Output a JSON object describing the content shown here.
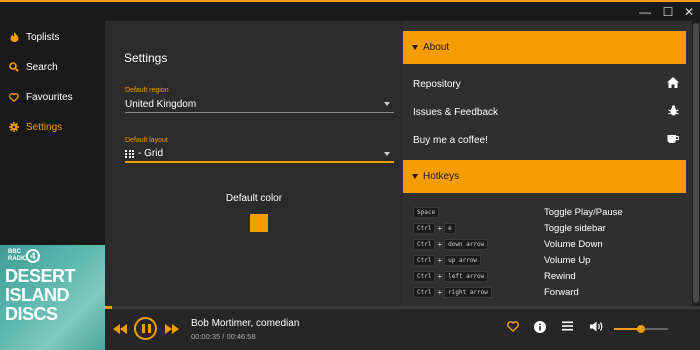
{
  "window": {
    "minimize_glyph": "—",
    "maximize_glyph": "☐",
    "close_glyph": "✕",
    "accent_color": "#f59c00"
  },
  "sidebar": {
    "items": [
      {
        "label": "Toplists",
        "icon": "flame-icon",
        "glyph": "🔥",
        "active": false
      },
      {
        "label": "Search",
        "icon": "search-icon",
        "glyph": "⌕",
        "active": false
      },
      {
        "label": "Favourites",
        "icon": "heart-icon",
        "glyph": "♡",
        "active": false
      },
      {
        "label": "Settings",
        "icon": "gear-icon",
        "glyph": "⚙",
        "active": true
      }
    ]
  },
  "album_art": {
    "bbc": "BBC",
    "radio": "RADIO",
    "four": "4",
    "line1": "DESERT",
    "line2": "ISLAND",
    "line3": "DISCS"
  },
  "settings": {
    "title": "Settings",
    "region_label": "Default region",
    "region_value": "United Kingdom",
    "layout_label": "Default layout",
    "layout_value": "- Grid",
    "default_color_label": "Default color",
    "default_color": "#f59c00"
  },
  "about": {
    "header": "About",
    "links": [
      {
        "label": "Repository",
        "icon": "home-icon",
        "glyph": "⌂"
      },
      {
        "label": "Issues & Feedback",
        "icon": "bug-icon",
        "glyph": "✱"
      },
      {
        "label": "Buy me a coffee!",
        "icon": "coffee-icon",
        "glyph": "☕"
      }
    ]
  },
  "hotkeys": {
    "header": "Hotkeys",
    "rows": [
      {
        "keys": [
          "Space"
        ],
        "action": "Toggle Play/Pause"
      },
      {
        "keys": [
          "Ctrl",
          "e"
        ],
        "action": "Toggle sidebar"
      },
      {
        "keys": [
          "Ctrl",
          "down arrow"
        ],
        "action": "Volume Down"
      },
      {
        "keys": [
          "Ctrl",
          "up arrow"
        ],
        "action": "Volume Up"
      },
      {
        "keys": [
          "Ctrl",
          "left arrow"
        ],
        "action": "Rewind"
      },
      {
        "keys": [
          "Ctrl",
          "right arrow"
        ],
        "action": "Forward"
      }
    ]
  },
  "player": {
    "title": "Bob Mortimer, comedian",
    "time": "00:00:35 / 00:46:58",
    "progress_fraction": 0.0125,
    "volume_fraction": 0.5,
    "rewind_glyph": "◀◀",
    "forward_glyph": "▶▶",
    "favourite_glyph": "♡",
    "info_glyph": "ⓘ",
    "menu_glyph": "☰",
    "volume_glyph": "🔊"
  }
}
